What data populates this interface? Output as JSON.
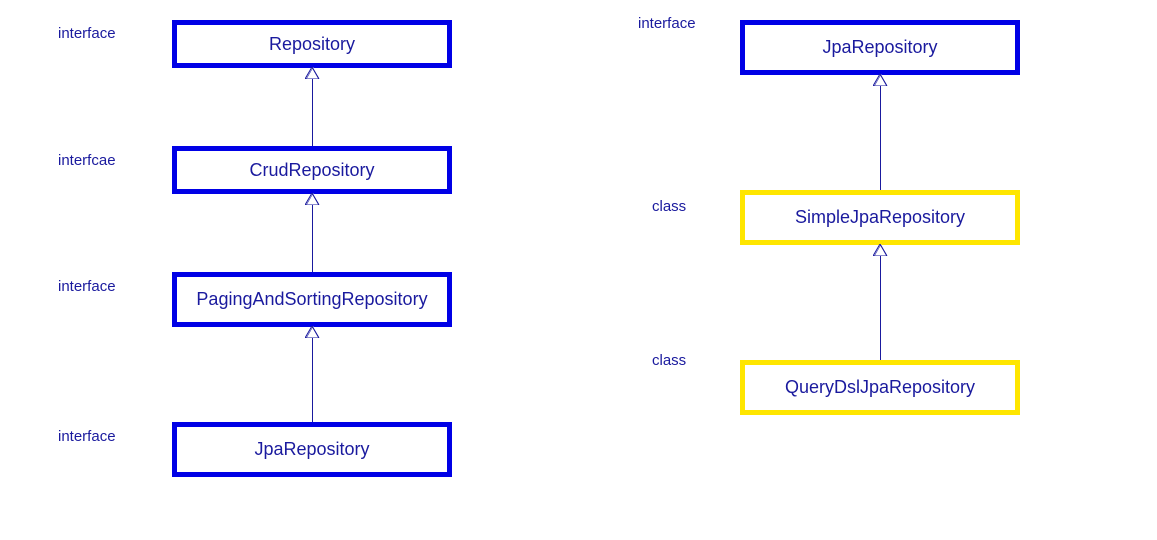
{
  "left": {
    "labels": [
      "interface",
      "interfcae",
      "interface",
      "interface"
    ],
    "boxes": [
      "Repository",
      "CrudRepository",
      "PagingAndSortingRepository",
      "JpaRepository"
    ]
  },
  "right": {
    "labels": [
      "interface",
      "class",
      "class"
    ],
    "boxes": [
      "JpaRepository",
      "SimpleJpaRepository",
      "QueryDslJpaRepository"
    ]
  }
}
